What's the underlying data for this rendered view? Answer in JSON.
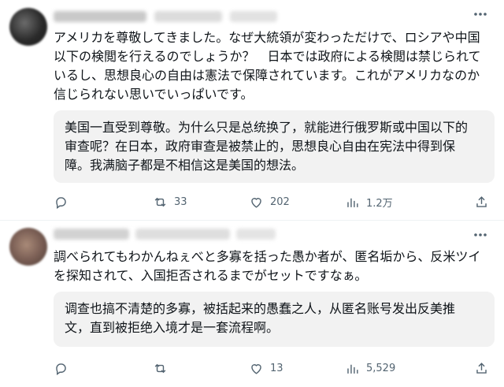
{
  "posts": [
    {
      "text": "アメリカを尊敬してきました。なぜ大統領が変わっただけで、ロシアや中国\n以下の検閲を行えるのでしょうか？　日本では政府による検閲は禁じられて\nいるし、思想良心の自由は憲法で保障されています。これがアメリカなのか\n信じられない思いでいっぱいです。",
      "translation": "美国一直受到尊敬。为什么只是总统换了，就能进行俄罗斯或中国以下的\n审查呢？在日本，政府审查是被禁止的，思想良心自由在宪法中得到保\n障。我满脑子都是不相信这是美国的想法。",
      "actions": {
        "reply": "",
        "repost": "33",
        "like": "202",
        "views": "1.2万"
      }
    },
    {
      "text": "調べられてもわかんねぇべと多寡を括った愚か者が、匿名垢から、反米ツイ\nを探知されて、入国拒否されるまでがセットですなぁ。",
      "translation": "调查也搞不清楚的多寡，被括起来的愚蠢之人，从匿名账号发出反美推\n文，直到被拒绝入境才是一套流程啊。",
      "actions": {
        "reply": "",
        "repost": "",
        "like": "13",
        "views": "5,529"
      }
    }
  ],
  "icons": {
    "reply": "reply-icon",
    "repost": "repost-icon",
    "like": "like-icon",
    "views": "views-icon",
    "share": "share-icon",
    "more": "more-icon"
  },
  "colors": {
    "text": "#0f1419",
    "muted": "#536471",
    "translation_bg": "#f2f2f2",
    "divider": "#eff3f4"
  }
}
